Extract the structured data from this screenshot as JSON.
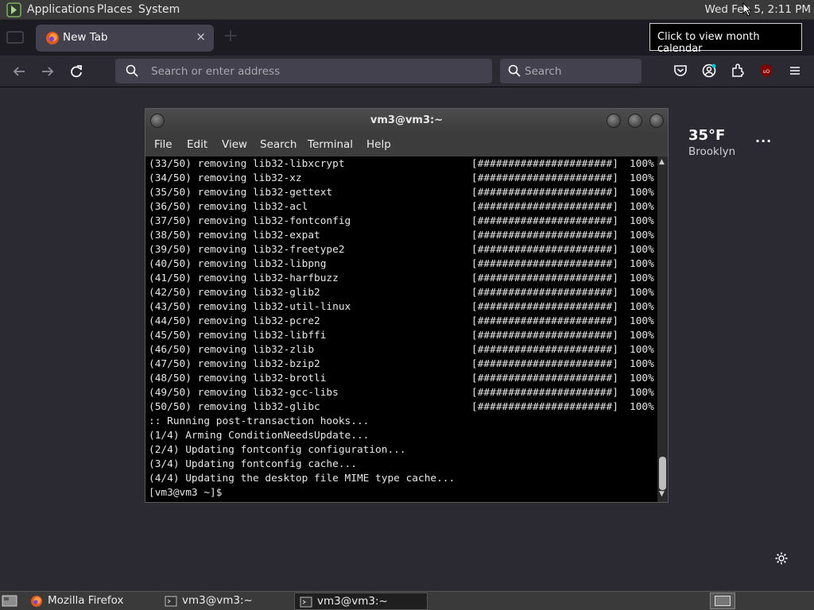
{
  "panel": {
    "menus": [
      "Applications",
      "Places",
      "System"
    ],
    "clock": "Wed Feb  5,  2:11 PM"
  },
  "tooltip": "Click to view month calendar",
  "browser": {
    "tab_title": "New Tab",
    "tab_close": "×",
    "url_placeholder": "Search or enter address",
    "search_placeholder": "Search",
    "accent": "#ff7139"
  },
  "weather": {
    "temp": "35°F",
    "city": "Brooklyn",
    "more": "···"
  },
  "terminal": {
    "title": "vm3@vm3:~",
    "menu": [
      "File",
      "Edit",
      "View",
      "Search",
      "Terminal",
      "Help"
    ],
    "progress_bar": "[######################]",
    "progress_pct": "100%",
    "removals": [
      "(33/50) removing lib32-libxcrypt",
      "(34/50) removing lib32-xz",
      "(35/50) removing lib32-gettext",
      "(36/50) removing lib32-acl",
      "(37/50) removing lib32-fontconfig",
      "(38/50) removing lib32-expat",
      "(39/50) removing lib32-freetype2",
      "(40/50) removing lib32-libpng",
      "(41/50) removing lib32-harfbuzz",
      "(42/50) removing lib32-glib2",
      "(43/50) removing lib32-util-linux",
      "(44/50) removing lib32-pcre2",
      "(45/50) removing lib32-libffi",
      "(46/50) removing lib32-zlib",
      "(47/50) removing lib32-bzip2",
      "(48/50) removing lib32-brotli",
      "(49/50) removing lib32-gcc-libs",
      "(50/50) removing lib32-glibc"
    ],
    "hooks": [
      ":: Running post-transaction hooks...",
      "(1/4) Arming ConditionNeedsUpdate...",
      "(2/4) Updating fontconfig configuration...",
      "(3/4) Updating fontconfig cache...",
      "(4/4) Updating the desktop file MIME type cache..."
    ],
    "prompt": "[vm3@vm3 ~]$"
  },
  "taskbar": {
    "tasks": [
      "Mozilla Firefox",
      "vm3@vm3:~",
      "vm3@vm3:~"
    ]
  }
}
